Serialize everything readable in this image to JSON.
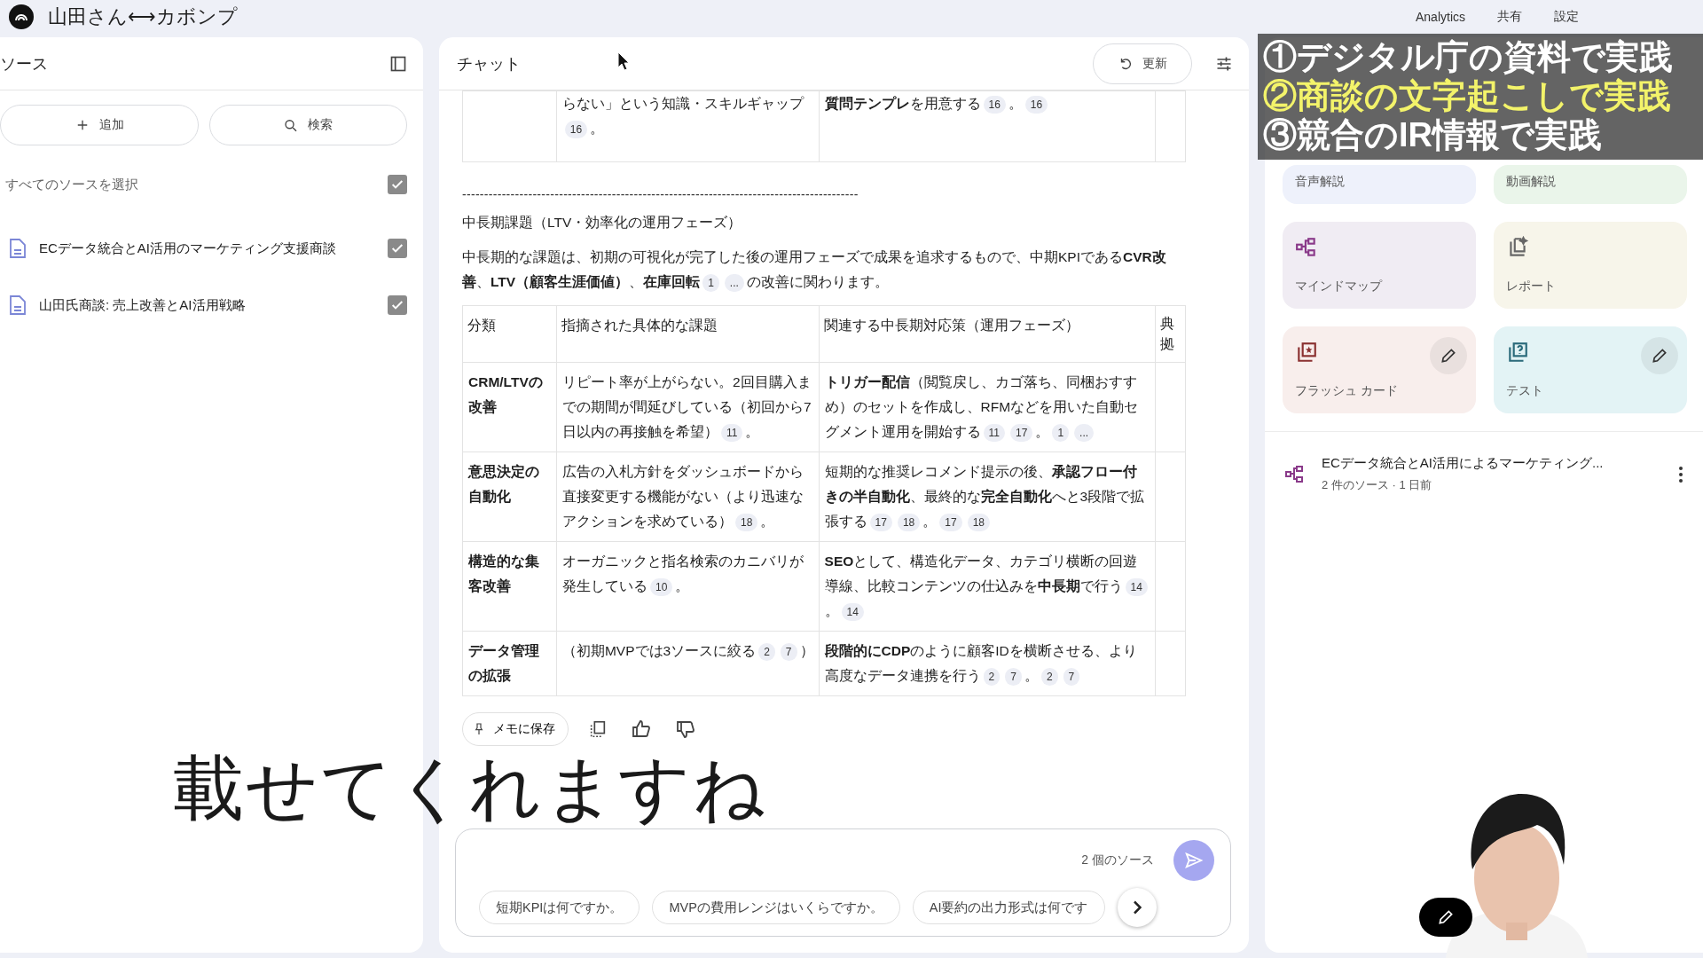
{
  "top_bar": {
    "title": "山田さん⟷カボンプ",
    "actions": [
      "Analytics",
      "共有",
      "設定"
    ]
  },
  "sources": {
    "title": "ソース",
    "buttons": [
      {
        "kind": "add",
        "label": "追加"
      },
      {
        "kind": "search",
        "label": "検索"
      }
    ],
    "select_all": {
      "label": "すべてのソースを選択",
      "checked": true
    },
    "items": [
      {
        "name": "ECデータ統合とAI活用のマーケティング支援商談",
        "checked": true
      },
      {
        "name": "山田氏商談: 売上改善とAI活用戦略",
        "checked": true
      }
    ]
  },
  "chat": {
    "title": "チャット",
    "refresh": "更新",
    "partial_row": {
      "column_2": [
        {
          "kind": "text",
          "text": "らない」という知識・スキルギャップ"
        },
        {
          "kind": "cite",
          "text": "16"
        },
        {
          "kind": "text",
          "text": "。"
        }
      ],
      "column_3": [
        {
          "kind": "text",
          "text": "**質問テンプレ**を用意する"
        },
        {
          "kind": "cite",
          "text": "16"
        },
        {
          "kind": "text",
          "text": "。"
        },
        {
          "kind": "cite",
          "text": "16"
        }
      ]
    },
    "divider": "------------------------------------------------------------------------------------------",
    "heading": "中長期課題（LTV・効率化の運用フェーズ）",
    "paragraph": [
      {
        "kind": "text",
        "text": "中長期的な課題は、初期の可視化が完了した後の運用フェーズで成果を追求するもので、中期KPIである**CVR改善**、**LTV（顧客生涯価値）**、**在庫回転**"
      },
      {
        "kind": "cite",
        "text": "1"
      },
      {
        "kind": "cite",
        "text": "..."
      },
      {
        "kind": "text",
        "text": "の改善に関わります。"
      }
    ],
    "table": {
      "columns": [
        "分類",
        "指摘された具体的な課題",
        "関連する中長期対応策（運用フェーズ）",
        "典拠"
      ],
      "rows": [
        [
          [
            {
              "kind": "text",
              "text": "CRM/LTVの改善"
            }
          ],
          [
            {
              "kind": "text",
              "text": "リピート率が上がらない。2回目購入までの期間が間延びしている（初回から7日以内の再接触を希望）"
            },
            {
              "kind": "cite",
              "text": "11"
            },
            {
              "kind": "text",
              "text": "。"
            }
          ],
          [
            {
              "kind": "text",
              "text": "**トリガー配信**（閲覧戻し、カゴ落ち、同梱おすすめ）のセットを作成し、RFMなどを用いた自動セグメント運用を開始する"
            },
            {
              "kind": "cite",
              "text": "11"
            },
            {
              "kind": "cite",
              "text": "17"
            },
            {
              "kind": "text",
              "text": "。"
            },
            {
              "kind": "cite",
              "text": "1"
            },
            {
              "kind": "cite",
              "text": "..."
            }
          ],
          []
        ],
        [
          [
            {
              "kind": "text",
              "text": "意思決定の自動化"
            }
          ],
          [
            {
              "kind": "text",
              "text": "広告の入札方針をダッシュボードから直接変更する機能がない（より迅速なアクションを求めている）"
            },
            {
              "kind": "cite",
              "text": "18"
            },
            {
              "kind": "text",
              "text": "。"
            }
          ],
          [
            {
              "kind": "text",
              "text": "短期的な推奨レコメンド提示の後、**承認フロー付きの半自動化**、最終的な**完全自動化**へと3段階で拡張する"
            },
            {
              "kind": "cite",
              "text": "17"
            },
            {
              "kind": "cite",
              "text": "18"
            },
            {
              "kind": "text",
              "text": "。"
            },
            {
              "kind": "cite",
              "text": "17"
            },
            {
              "kind": "cite",
              "text": "18"
            }
          ],
          []
        ],
        [
          [
            {
              "kind": "text",
              "text": "構造的な集客改善"
            }
          ],
          [
            {
              "kind": "text",
              "text": "オーガニックと指名検索のカニバリが発生している"
            },
            {
              "kind": "cite",
              "text": "10"
            },
            {
              "kind": "text",
              "text": "。"
            }
          ],
          [
            {
              "kind": "text",
              "text": "**SEO**として、構造化データ、カテゴリ横断の回遊導線、比較コンテンツの仕込みを**中長期**で行う"
            },
            {
              "kind": "cite",
              "text": "14"
            },
            {
              "kind": "text",
              "text": "。"
            },
            {
              "kind": "cite",
              "text": "14"
            }
          ],
          []
        ],
        [
          [
            {
              "kind": "text",
              "text": "データ管理の拡張"
            }
          ],
          [
            {
              "kind": "text",
              "text": "（初期MVPでは3ソースに絞る"
            },
            {
              "kind": "cite",
              "text": "2"
            },
            {
              "kind": "cite",
              "text": "7"
            },
            {
              "kind": "text",
              "text": "）"
            }
          ],
          [
            {
              "kind": "text",
              "text": "**段階的にCDP**のように顧客IDを横断させる、より高度なデータ連携を行う"
            },
            {
              "kind": "cite",
              "text": "2"
            },
            {
              "kind": "cite",
              "text": "7"
            },
            {
              "kind": "text",
              "text": "。"
            },
            {
              "kind": "cite",
              "text": "2"
            },
            {
              "kind": "cite",
              "text": "7"
            }
          ],
          []
        ]
      ]
    },
    "save_note": "メモに保存",
    "source_count": "2 個のソース",
    "suggestions": [
      "短期KPIは何ですか。",
      "MVPの費用レンジはいくらですか。",
      "AI要約の出力形式は何です"
    ]
  },
  "studio": {
    "cards": [
      {
        "kind": "audio",
        "label": "音声解説",
        "color": "#eef1fb",
        "editable": false
      },
      {
        "kind": "video",
        "label": "動画解説",
        "color": "#eaf5ea",
        "editable": false
      },
      {
        "kind": "mindmap",
        "label": "マインドマップ",
        "color": "#f0ecf3",
        "editable": false
      },
      {
        "kind": "report",
        "label": "レポート",
        "color": "#f7f5ea",
        "editable": false
      },
      {
        "kind": "flashcard",
        "label": "フラッシュ カード",
        "color": "#f8eeec",
        "editable": true
      },
      {
        "kind": "quiz",
        "label": "テスト",
        "color": "#e3f3f5",
        "editable": true
      }
    ],
    "note": {
      "title": "ECデータ統合とAI活用によるマーケティング...",
      "meta": "2 件のソース · 1 日前"
    }
  },
  "banner": [
    {
      "text": "①デジタル庁の資料で実践",
      "highlighted": false
    },
    {
      "text": "②商談の文字起こしで実践",
      "highlighted": true
    },
    {
      "text": "③競合のIR情報で実践",
      "highlighted": false
    }
  ],
  "subtitle": "載せてくれますね"
}
